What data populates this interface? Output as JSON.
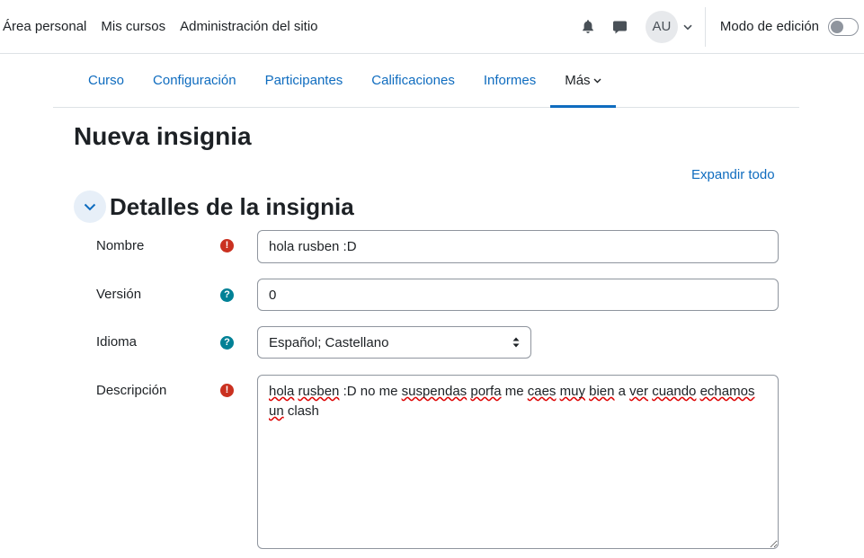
{
  "topnav": {
    "items": [
      "Área personal",
      "Mis cursos",
      "Administración del sitio"
    ],
    "avatar_initials": "AU",
    "edit_mode_label": "Modo de edición",
    "edit_mode_on": false
  },
  "secondary_nav": {
    "tabs": [
      "Curso",
      "Configuración",
      "Participantes",
      "Calificaciones",
      "Informes",
      "Más"
    ],
    "active": "Más"
  },
  "page": {
    "title": "Nueva insignia",
    "expand_all": "Expandir todo",
    "section_title": "Detalles de la insignia"
  },
  "form": {
    "name": {
      "label": "Nombre",
      "value": "hola rusben :D"
    },
    "version": {
      "label": "Versión",
      "value": "0"
    },
    "language": {
      "label": "Idioma",
      "value": "Español; Castellano"
    },
    "description": {
      "label": "Descripción",
      "value": "hola rusben :D no me suspendas porfa me caes muy bien a ver cuando echamos un clash"
    }
  },
  "colors": {
    "link": "#0f6cbf",
    "required_icon": "#ca3120",
    "help_icon": "#008196",
    "text": "#1d2125"
  }
}
